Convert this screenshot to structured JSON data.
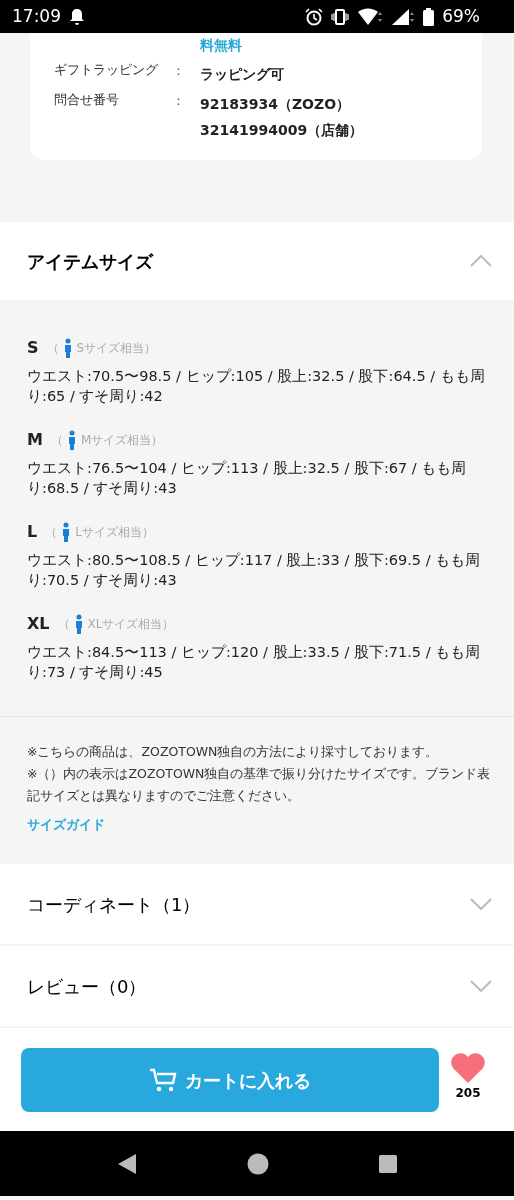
{
  "status_bar": {
    "time": "17:09",
    "battery": "69%"
  },
  "info_card": {
    "cut_text": "料無料",
    "rows": [
      {
        "label": "ギフトラッピング",
        "separator": "：",
        "values": [
          "ラッピング可"
        ]
      },
      {
        "label": "問合せ番号",
        "separator": "：",
        "values": [
          "92183934（ZOZO）",
          "32141994009（店舗）"
        ]
      }
    ]
  },
  "size_section": {
    "title": "アイテムサイズ",
    "expanded": true,
    "sizes": [
      {
        "size": "S",
        "equivalent": "Sサイズ相当",
        "open": "（",
        "close": "）",
        "measurements": "ウエスト:70.5〜98.5 / ヒップ:105 / 股上:32.5 / 股下:64.5 / もも周り:65 / すそ周り:42"
      },
      {
        "size": "M",
        "equivalent": "Mサイズ相当",
        "open": "（",
        "close": "）",
        "measurements": "ウエスト:76.5〜104 / ヒップ:113 / 股上:32.5 / 股下:67 / もも周り:68.5 / すそ周り:43"
      },
      {
        "size": "L",
        "equivalent": "Lサイズ相当",
        "open": "（",
        "close": "）",
        "measurements": "ウエスト:80.5〜108.5 / ヒップ:117 / 股上:33 / 股下:69.5 / もも周り:70.5 / すそ周り:43"
      },
      {
        "size": "XL",
        "equivalent": "XLサイズ相当",
        "open": "（",
        "close": "）",
        "measurements": "ウエスト:84.5〜113 / ヒップ:120 / 股上:33.5 / 股下:71.5 / もも周り:73 / すそ周り:45"
      }
    ],
    "notes": [
      "※こちらの商品は、ZOZOTOWN独自の方法により採寸しております。",
      "※（）内の表示はZOZOTOWN独自の基準で振り分けたサイズです。ブランド表記サイズとは異なりますのでご注意ください。"
    ],
    "guide_link": "サイズガイド"
  },
  "accordions": [
    {
      "title": "コーディネート（1）",
      "expanded": false
    },
    {
      "title": "レビュー（0）",
      "expanded": false
    }
  ],
  "cart_button": "カートに入れる",
  "favorite_count": "205"
}
